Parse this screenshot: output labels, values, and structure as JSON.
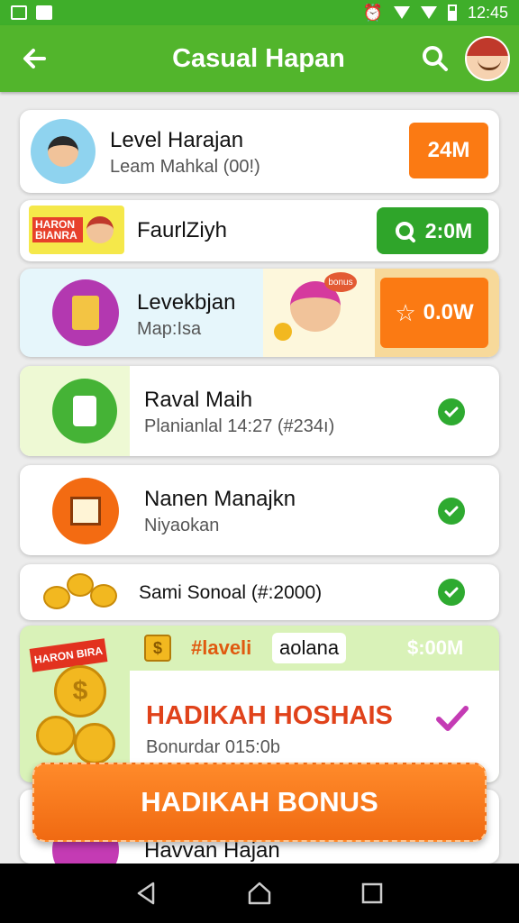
{
  "status": {
    "time": "12:45"
  },
  "appbar": {
    "title": "Casual Hapan",
    "back_icon": "back-arrow-icon",
    "search_icon": "search-icon"
  },
  "items": [
    {
      "title": "Level Harajan",
      "subtitle": "Leam Mahkal (00!)",
      "action": "24M"
    },
    {
      "badge": "HARON BIANRA",
      "title": "FaurlZiyh",
      "action": "2:0M"
    },
    {
      "title": "Levekbjan",
      "subtitle": "Map:Isa",
      "art_label": "bonus",
      "action": "0.0W"
    },
    {
      "title": "Raval Maih",
      "subtitle": "Planianlal 14:27 (#234ı)"
    },
    {
      "title": "Nanen Manajkn",
      "subtitle": "Niyaokan"
    },
    {
      "title": "Sami Sonoal (#:2000)"
    },
    {
      "header": "#laveli",
      "header_pill": "aolana",
      "header_value": "$:00M",
      "art_label": "HARON BIRA",
      "title": "HADIKAH HOSHAIS",
      "subtitle": "Bonurdar 015:0b"
    },
    {
      "title": "Havvan Hajan"
    }
  ],
  "bonus_button": {
    "label": "HADIKAH BONUS"
  },
  "colors": {
    "green": "#52b52c",
    "orange": "#fb7a13",
    "purple": "#c43bb4"
  }
}
